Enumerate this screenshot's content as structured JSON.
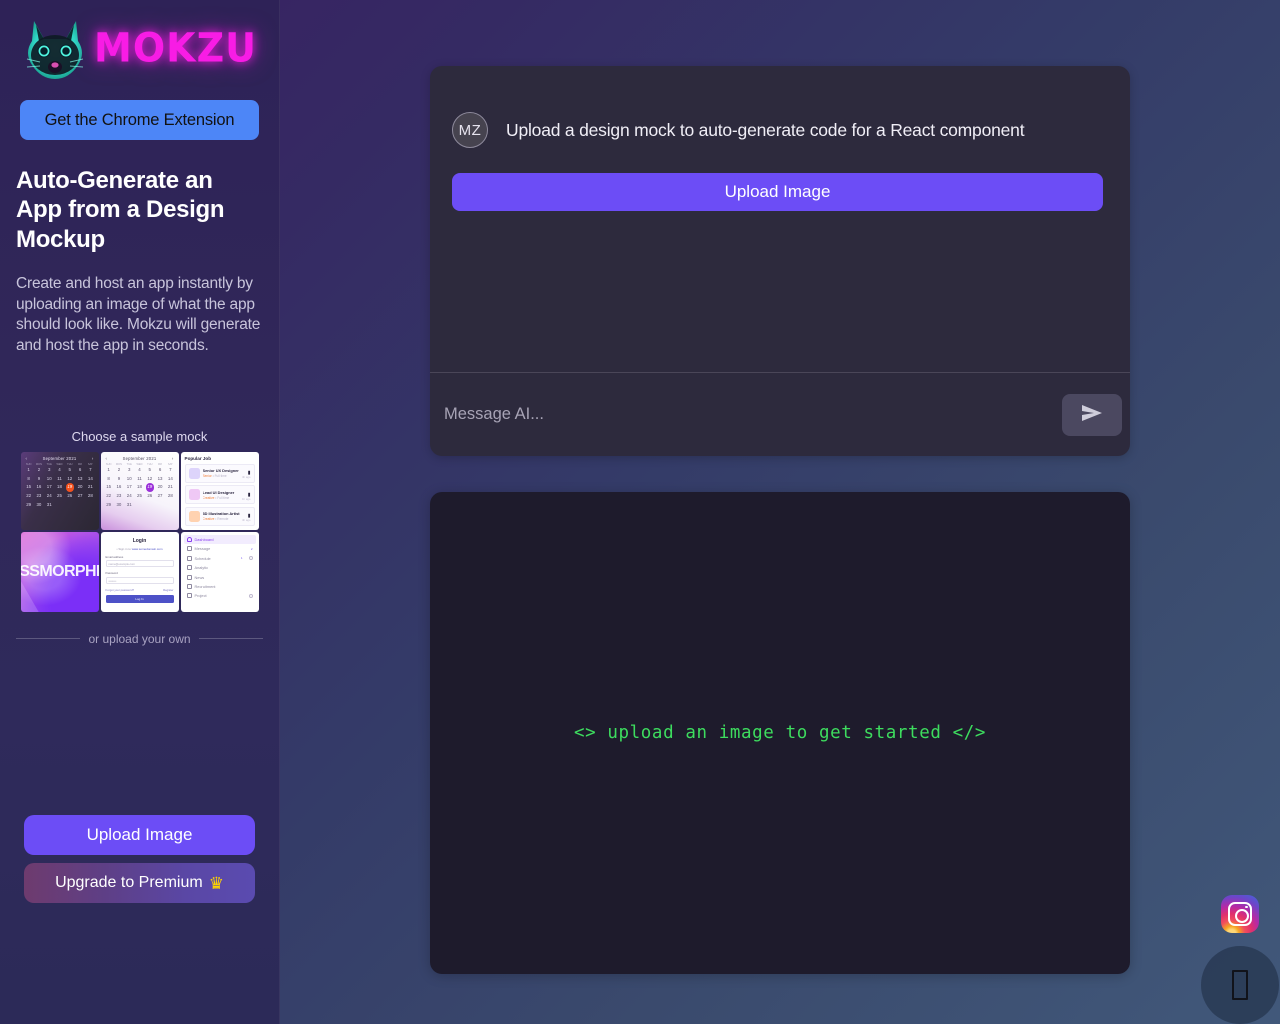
{
  "brand": {
    "wordmark": "MOKZU",
    "logo_icon": "mokzu-cat-logo-icon"
  },
  "sidebar": {
    "chrome_extension_button": "Get the Chrome Extension",
    "headline": "Auto-Generate an App from a Design Mockup",
    "subcopy": "Create and host an app instantly by uploading an image of what the app should look like. Mokzu will generate and host the app in seconds.",
    "sample_mock_label": "Choose a sample mock",
    "divider_text": "or upload your own",
    "upload_button": "Upload Image",
    "premium_button": "Upgrade to Premium",
    "premium_icon": "crown-icon",
    "mocks": [
      {
        "name": "dark-calendar-mock",
        "title": "September 2021",
        "prev": "‹",
        "next": "›",
        "dow": [
          "SUN",
          "MON",
          "TUE",
          "WED",
          "THU",
          "FRI",
          "SAT"
        ],
        "weeks": [
          [
            "1",
            "2",
            "3",
            "4",
            "5",
            "6",
            "7"
          ],
          [
            "8",
            "9",
            "10",
            "11",
            "12",
            "13",
            "14"
          ],
          [
            "15",
            "16",
            "17",
            "18",
            "19",
            "20",
            "21"
          ],
          [
            "22",
            "23",
            "24",
            "25",
            "26",
            "27",
            "28"
          ],
          [
            "29",
            "30",
            "31",
            "",
            "",
            "",
            ""
          ]
        ],
        "selected": "19"
      },
      {
        "name": "light-calendar-mock",
        "title": "September 2021",
        "prev": "‹",
        "next": "›",
        "dow": [
          "SUN",
          "MON",
          "TUE",
          "WED",
          "THU",
          "FRI",
          "SAT"
        ],
        "weeks": [
          [
            "1",
            "2",
            "3",
            "4",
            "5",
            "6",
            "7"
          ],
          [
            "8",
            "9",
            "10",
            "11",
            "12",
            "13",
            "14"
          ],
          [
            "15",
            "16",
            "17",
            "18",
            "19",
            "20",
            "21"
          ],
          [
            "22",
            "23",
            "24",
            "25",
            "26",
            "27",
            "28"
          ],
          [
            "29",
            "30",
            "31",
            "",
            "",
            "",
            ""
          ]
        ],
        "selected": "19"
      },
      {
        "name": "popular-job-mock",
        "title": "Popular Job",
        "jobs": [
          {
            "title": "Senior UX Designer",
            "tag": "Senior",
            "meta": "Full time",
            "time": "4h ago",
            "color": "#ddd4fb"
          },
          {
            "title": "Lead UI Designer",
            "tag": "Creative",
            "meta": "Full time",
            "time": "1h ago",
            "color": "#efc8f5"
          },
          {
            "title": "3D Illustration Artist",
            "tag": "Creative",
            "meta": "Remote",
            "time": "4h ago",
            "color": "#ffd2b0"
          }
        ],
        "bookmark_icon": "bookmark-icon"
      },
      {
        "name": "ssmorphi-gradient-mock",
        "text": "SSMORPHI"
      },
      {
        "name": "login-form-mock",
        "title": "Login",
        "subtitle_pre": "• Sign in to",
        "subtitle_link": "www.somedomain.com",
        "email_label": "Email address",
        "email_value": "name@example.com",
        "password_label": "Password",
        "password_value": "••••••••",
        "forgot": "Forgot your password?",
        "register": "Register",
        "submit": "Log In"
      },
      {
        "name": "dashboard-nav-mock",
        "items": [
          {
            "label": "Dashboard",
            "icon": "home-icon",
            "active": true,
            "badge": ""
          },
          {
            "label": "Message",
            "icon": "chat-icon",
            "active": false,
            "badge": "2"
          },
          {
            "label": "Schedule",
            "icon": "clock-icon",
            "active": false,
            "badge": "1",
            "dot": true
          },
          {
            "label": "Analytic",
            "icon": "chart-icon",
            "active": false,
            "badge": ""
          },
          {
            "label": "News",
            "icon": "news-icon",
            "active": false,
            "badge": ""
          },
          {
            "label": "Recruitment",
            "icon": "briefcase-icon",
            "active": false,
            "badge": ""
          },
          {
            "label": "Project",
            "icon": "folder-icon",
            "active": false,
            "badge": "",
            "dot": true
          }
        ]
      }
    ]
  },
  "chat": {
    "avatar_initials": "MZ",
    "message": "Upload a design mock to auto-generate code for a React component",
    "upload_button": "Upload Image",
    "input_value": "",
    "input_placeholder": "Message AI...",
    "send_icon": "send-icon"
  },
  "code_panel": {
    "placeholder": "<> upload an image to get started </>"
  },
  "floating": {
    "instagram_icon": "instagram-icon",
    "chat_fab_icon": "chat-bubble-icon"
  },
  "colors": {
    "accent_purple": "#6c4df6",
    "brand_pink": "#f81ce5",
    "chrome_blue": "#4d86f7",
    "code_green": "#3ddc5e",
    "sidebar_bg": "#2f2659",
    "card_bg": "#2d2a3d",
    "code_bg": "#1e1b2c",
    "crown_yellow": "#ffd400"
  }
}
